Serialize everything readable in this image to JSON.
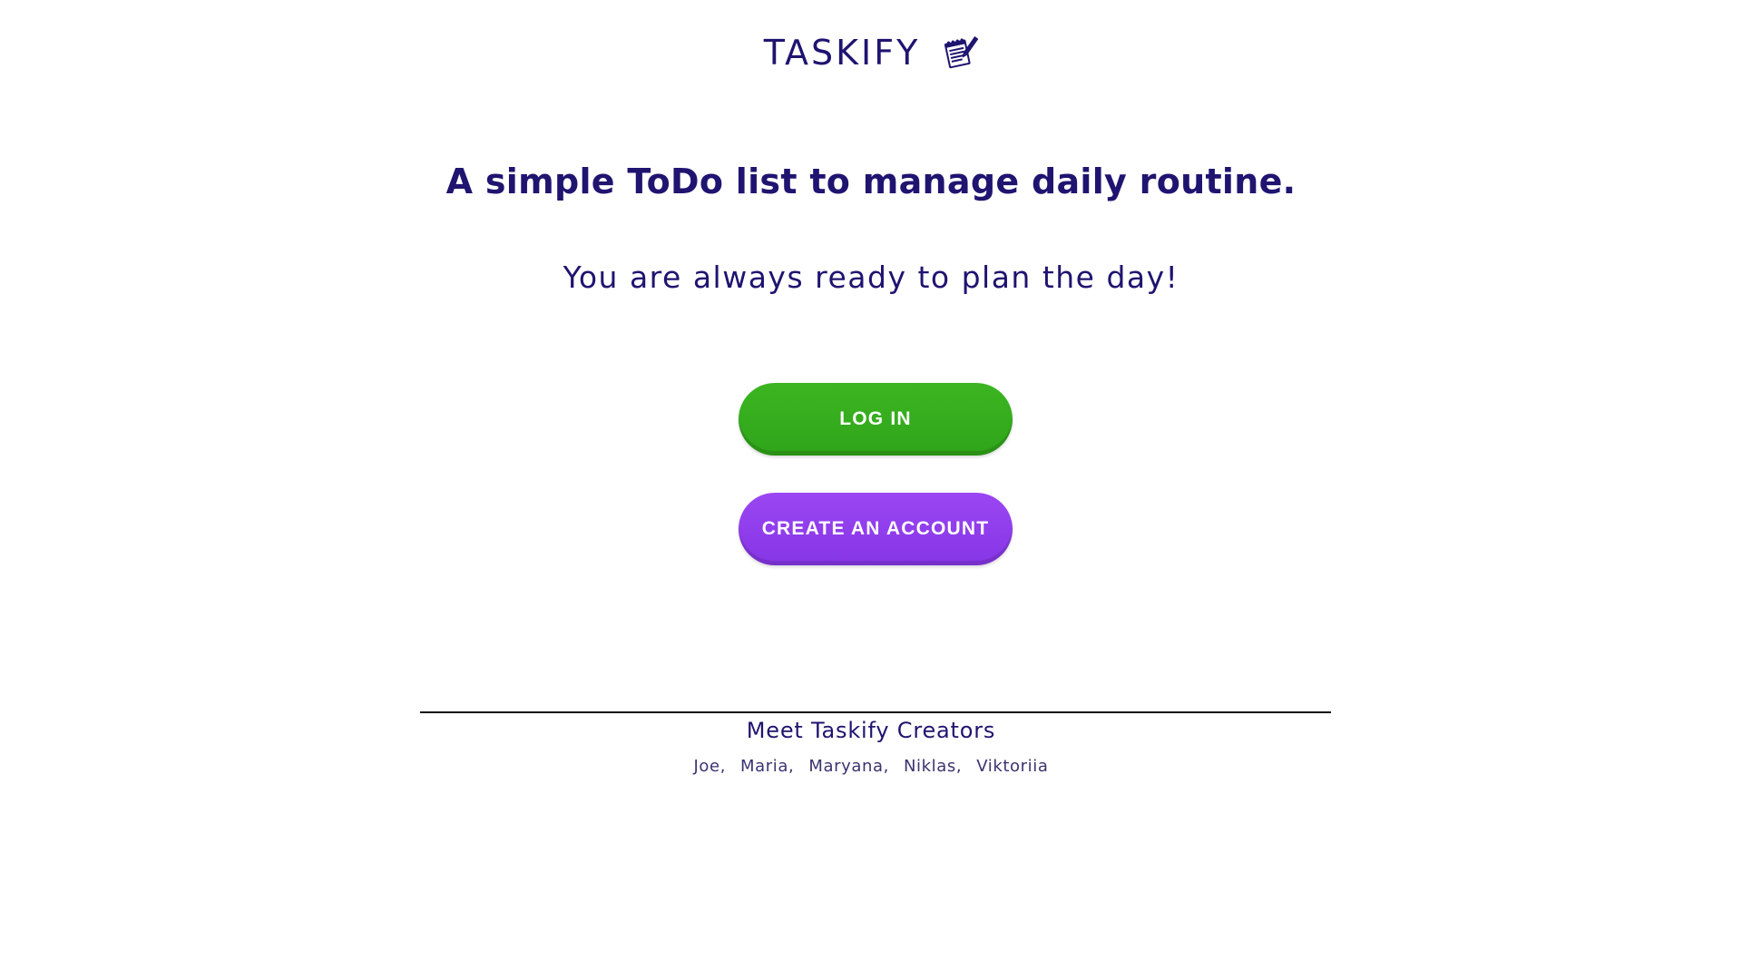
{
  "header": {
    "logo_text": "TASKIFY",
    "logo_icon": "notepad-pencil-icon"
  },
  "hero": {
    "tagline": "A simple ToDo list to manage daily routine.",
    "subtitle": "You are always ready to plan the day!"
  },
  "actions": {
    "login_label": "LOG IN",
    "create_account_label": "CREATE AN ACCOUNT"
  },
  "footer": {
    "creators_title": "Meet Taskify Creators",
    "creators": [
      "Joe,",
      "Maria,",
      "Maryana,",
      "Niklas,",
      "Viktoriia"
    ]
  },
  "colors": {
    "text_primary": "#1f1470",
    "login_button": "#34ad1e",
    "create_button": "#8f3ff0",
    "background": "#ffffff"
  }
}
